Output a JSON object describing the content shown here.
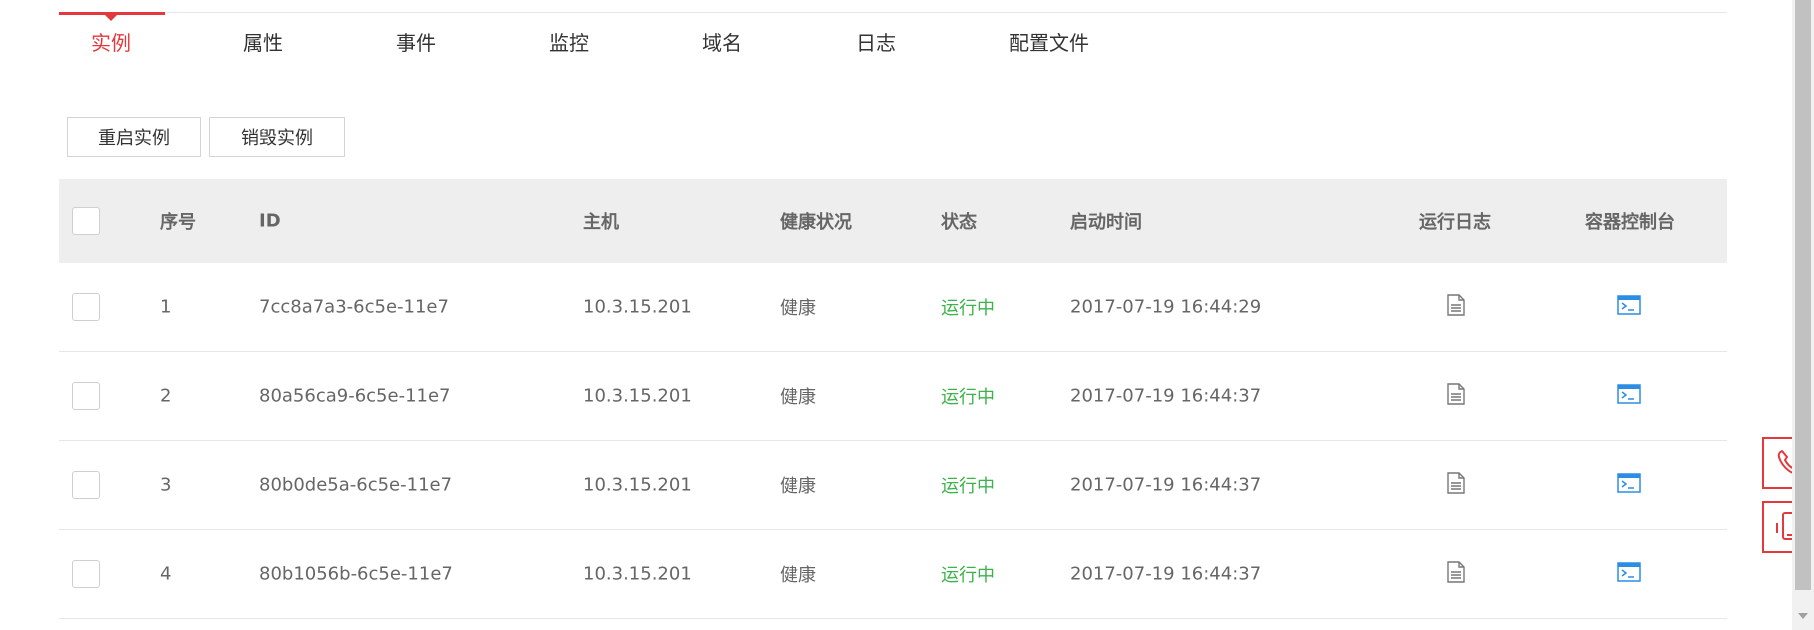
{
  "tabs": [
    {
      "label": "实例",
      "active": true
    },
    {
      "label": "属性"
    },
    {
      "label": "事件"
    },
    {
      "label": "监控"
    },
    {
      "label": "域名"
    },
    {
      "label": "日志"
    },
    {
      "label": "配置文件"
    }
  ],
  "actions": {
    "restart_label": "重启实例",
    "destroy_label": "销毁实例"
  },
  "table": {
    "headers": {
      "seq": "序号",
      "id": "ID",
      "host": "主机",
      "health": "健康状况",
      "status": "状态",
      "start_time": "启动时间",
      "log": "运行日志",
      "console": "容器控制台"
    },
    "rows": [
      {
        "seq": "1",
        "id": "7cc8a7a3-6c5e-11e7",
        "host": "10.3.15.201",
        "health": "健康",
        "status": "运行中",
        "start_time": "2017-07-19 16:44:29"
      },
      {
        "seq": "2",
        "id": "80a56ca9-6c5e-11e7",
        "host": "10.3.15.201",
        "health": "健康",
        "status": "运行中",
        "start_time": "2017-07-19 16:44:37"
      },
      {
        "seq": "3",
        "id": "80b0de5a-6c5e-11e7",
        "host": "10.3.15.201",
        "health": "健康",
        "status": "运行中",
        "start_time": "2017-07-19 16:44:37"
      },
      {
        "seq": "4",
        "id": "80b1056b-6c5e-11e7",
        "host": "10.3.15.201",
        "health": "健康",
        "status": "运行中",
        "start_time": "2017-07-19 16:44:37"
      }
    ]
  },
  "icons": {
    "log": "document-icon",
    "console": "terminal-icon",
    "call": "phone-icon",
    "mobile": "mobile-icon"
  },
  "colors": {
    "accent": "#e4393c",
    "status_running": "#3bb34a",
    "console_icon": "#2b8de4",
    "header_bg": "#eeeeee"
  }
}
